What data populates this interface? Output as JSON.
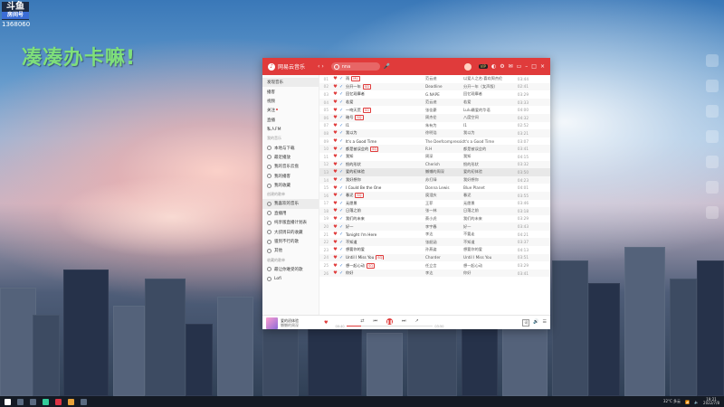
{
  "overlay": {
    "logo_main": "斗鱼",
    "logo_sub": "房间号",
    "room_id": "1368060",
    "banner": "凑凑办卡嘛!"
  },
  "app": {
    "name": "网易云音乐",
    "search_text": "nna",
    "user_name": "",
    "vip_badge": "VIP",
    "sidebar": {
      "items": [
        {
          "label": "发现音乐",
          "active": true
        },
        {
          "label": "播客"
        },
        {
          "label": "视频"
        },
        {
          "label": "关注"
        },
        {
          "label": "直播"
        },
        {
          "label": "私人FM"
        }
      ],
      "my_music_header": "我的音乐",
      "my_music": [
        "本地与下载",
        "最近播放",
        "我的音乐云盘",
        "我的播客",
        "我的收藏"
      ],
      "playlists_header": "创建的歌单",
      "playlists": [
        "我喜欢的音乐",
        "直播用",
        "纯享版直播计划表",
        "大叔周日的收藏",
        "骚到不行的歌",
        "其他"
      ],
      "collected_header": "收藏的歌单",
      "collected": [
        "最让你难受的歌",
        "Lofi"
      ]
    },
    "songs": [
      {
        "idx": "01",
        "title": "雨",
        "tag": "MV",
        "artist": "范云迪",
        "album": "以爱人之名·喜欢周杰伦",
        "dur": "03:44"
      },
      {
        "idx": "02",
        "title": "分开一年",
        "tag": "SQ",
        "artist": "Deadline",
        "album": "分开一年（女声版）",
        "dur": "02:41"
      },
      {
        "idx": "03",
        "title": "回忆观摩者",
        "tag": "",
        "artist": "G.NAPE",
        "album": "回忆观摩者",
        "dur": "03:29"
      },
      {
        "idx": "04",
        "title": "若爱",
        "tag": "",
        "artist": "范云迪",
        "album": "若爱",
        "dur": "03:33"
      },
      {
        "idx": "05",
        "title": "一吻天荒",
        "tag": "SQ",
        "artist": "张佳豪",
        "album": "Lulu最爱的华语",
        "dur": "04:00"
      },
      {
        "idx": "06",
        "title": "暗号",
        "tag": "SQ",
        "artist": "周杰伦",
        "album": "八度空间",
        "dur": "04:32"
      },
      {
        "idx": "07",
        "title": "I1",
        "tag": "",
        "artist": "朱有为",
        "album": "I1",
        "dur": "02:52"
      },
      {
        "idx": "08",
        "title": "我以为",
        "tag": "",
        "artist": "徐明浩",
        "album": "我以为",
        "dur": "03:21"
      },
      {
        "idx": "09",
        "title": "It's a Good Time",
        "tag": "",
        "artist": "The Deefcompressions",
        "album": "It's a Good Time",
        "dur": "03:07"
      },
      {
        "idx": "10",
        "title": "都是被误会的",
        "tag": "SQ",
        "artist": "R.H",
        "album": "都是被误会的",
        "dur": "03:41"
      },
      {
        "idx": "11",
        "title": "我知",
        "tag": "",
        "artist": "周深",
        "album": "我知",
        "dur": "04:15"
      },
      {
        "idx": "12",
        "title": "恨的形状",
        "tag": "",
        "artist": "Cherish",
        "album": "恨的形状",
        "dur": "03:32"
      },
      {
        "idx": "13",
        "title": "爱的初体验",
        "tag": "",
        "artist": "懒懒的周深",
        "album": "爱的初体验",
        "dur": "03:50",
        "playing": true
      },
      {
        "idx": "14",
        "title": "我好想你",
        "tag": "",
        "artist": "苏打绿",
        "album": "我好想你",
        "dur": "04:23"
      },
      {
        "idx": "15",
        "title": "I Could Be the One",
        "tag": "",
        "artist": "Donna Lewis",
        "album": "Blue Planet",
        "dur": "04:01"
      },
      {
        "idx": "16",
        "title": "春泥",
        "tag": "SQ",
        "artist": "庾澄庆",
        "album": "春泥",
        "dur": "03:55"
      },
      {
        "idx": "17",
        "title": "无愿景",
        "tag": "",
        "artist": "王菲",
        "album": "无愿景",
        "dur": "03:46"
      },
      {
        "idx": "18",
        "title": "日落之前",
        "tag": "",
        "artist": "张一林",
        "album": "日落之前",
        "dur": "03:18"
      },
      {
        "idx": "19",
        "title": "我们的未来",
        "tag": "",
        "artist": "蔡小虎",
        "album": "我们的未来",
        "dur": "03:29"
      },
      {
        "idx": "20",
        "title": "好一",
        "tag": "",
        "artist": "李宇春",
        "album": "好一",
        "dur": "03:43"
      },
      {
        "idx": "21",
        "title": "Tonight I'm Here",
        "tag": "",
        "artist": "李达",
        "album": "不要走",
        "dur": "04:21"
      },
      {
        "idx": "22",
        "title": "不知道",
        "tag": "",
        "artist": "张韶涵",
        "album": "不知道",
        "dur": "03:37"
      },
      {
        "idx": "23",
        "title": "想要你的爱",
        "tag": "",
        "artist": "孙燕姿",
        "album": "想要你的爱",
        "dur": "04:13"
      },
      {
        "idx": "24",
        "title": "Until I Miss You",
        "tag": "SQ",
        "artist": "Chorder",
        "album": "Until I Miss You",
        "dur": "03:51"
      },
      {
        "idx": "25",
        "title": "想一起心动",
        "tag": "SQ",
        "artist": "任立言",
        "album": "想一起心动",
        "dur": "03:29"
      },
      {
        "idx": "26",
        "title": "你好",
        "tag": "",
        "artist": "李达",
        "album": "你好",
        "dur": "03:41"
      }
    ],
    "player": {
      "title": "爱的初体验",
      "artist": "懒懒的周深",
      "elapsed": "00:40",
      "duration": "03:50",
      "progress": 0.17,
      "lyric_label": "词"
    }
  },
  "taskbar": {
    "weather": "32°C 多云",
    "time": "19:21",
    "date": "2022/7/8"
  }
}
